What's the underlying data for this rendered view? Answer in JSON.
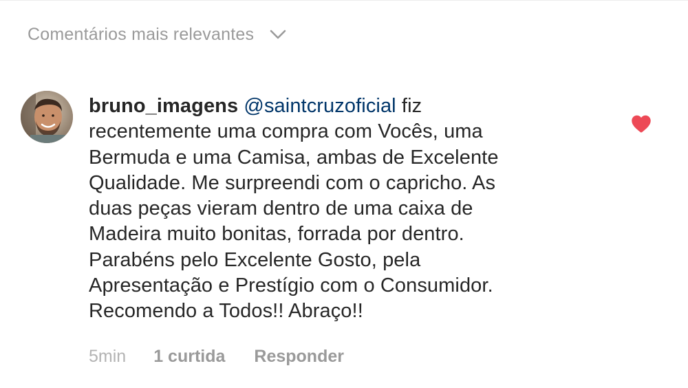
{
  "comments_header": {
    "sort_label": "Comentários mais relevantes",
    "chevron_icon": "chevron-down-icon"
  },
  "comment": {
    "avatar_icon": "user-avatar",
    "username": "bruno_imagens",
    "mention": "@saintcruzoficial",
    "text": "fiz\nrecentemente uma compra com Vocês, uma\nBermuda e uma Camisa, ambas de Excelente\nQualidade. Me surpreendi com o capricho. As\nduas peças vieram dentro de uma caixa de\nMadeira muito bonitas, forrada por dentro.\nParabéns pelo Excelente Gosto, pela\nApresentação e Prestígio com o Consumidor.\nRecomendo a Todos!! Abraço!!",
    "liked": true,
    "heart_icon": "heart-filled-icon",
    "heart_color": "#ed4956",
    "time": "5min",
    "likes": "1 curtida",
    "reply_label": "Responder"
  },
  "colors": {
    "text": "#262626",
    "secondary": "#9a9a9a",
    "mention": "#003569"
  }
}
